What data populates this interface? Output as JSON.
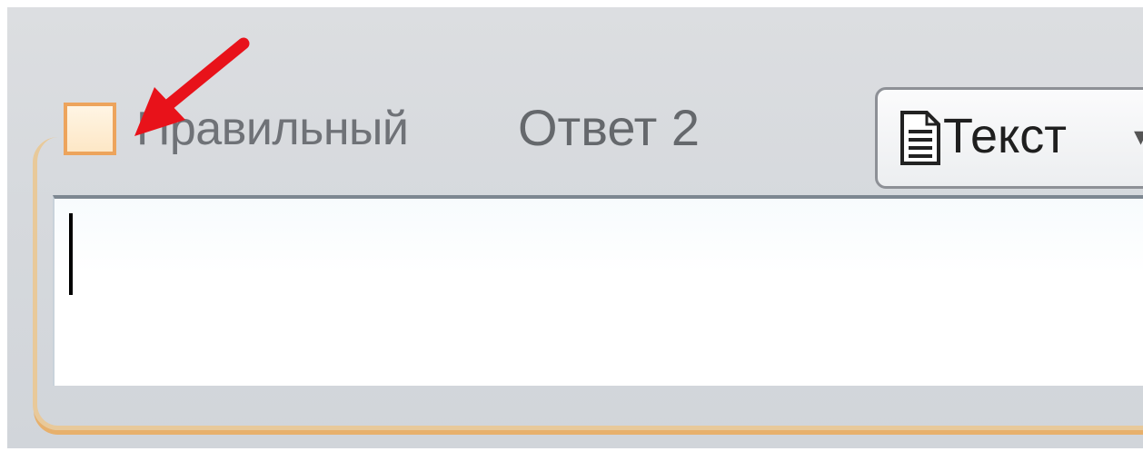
{
  "answer_block": {
    "correct_checkbox": {
      "label": "Правильный",
      "checked": false
    },
    "title": "Ответ 2",
    "type_dropdown": {
      "selected": "Текст",
      "icon": "document-icon"
    },
    "input": {
      "value": ""
    }
  },
  "annotation": {
    "arrow_color": "#e8121a"
  },
  "colors": {
    "frame_border": "#e8c99a",
    "checkbox_border": "#eda45c",
    "panel_bg": "#d6d9dd"
  }
}
